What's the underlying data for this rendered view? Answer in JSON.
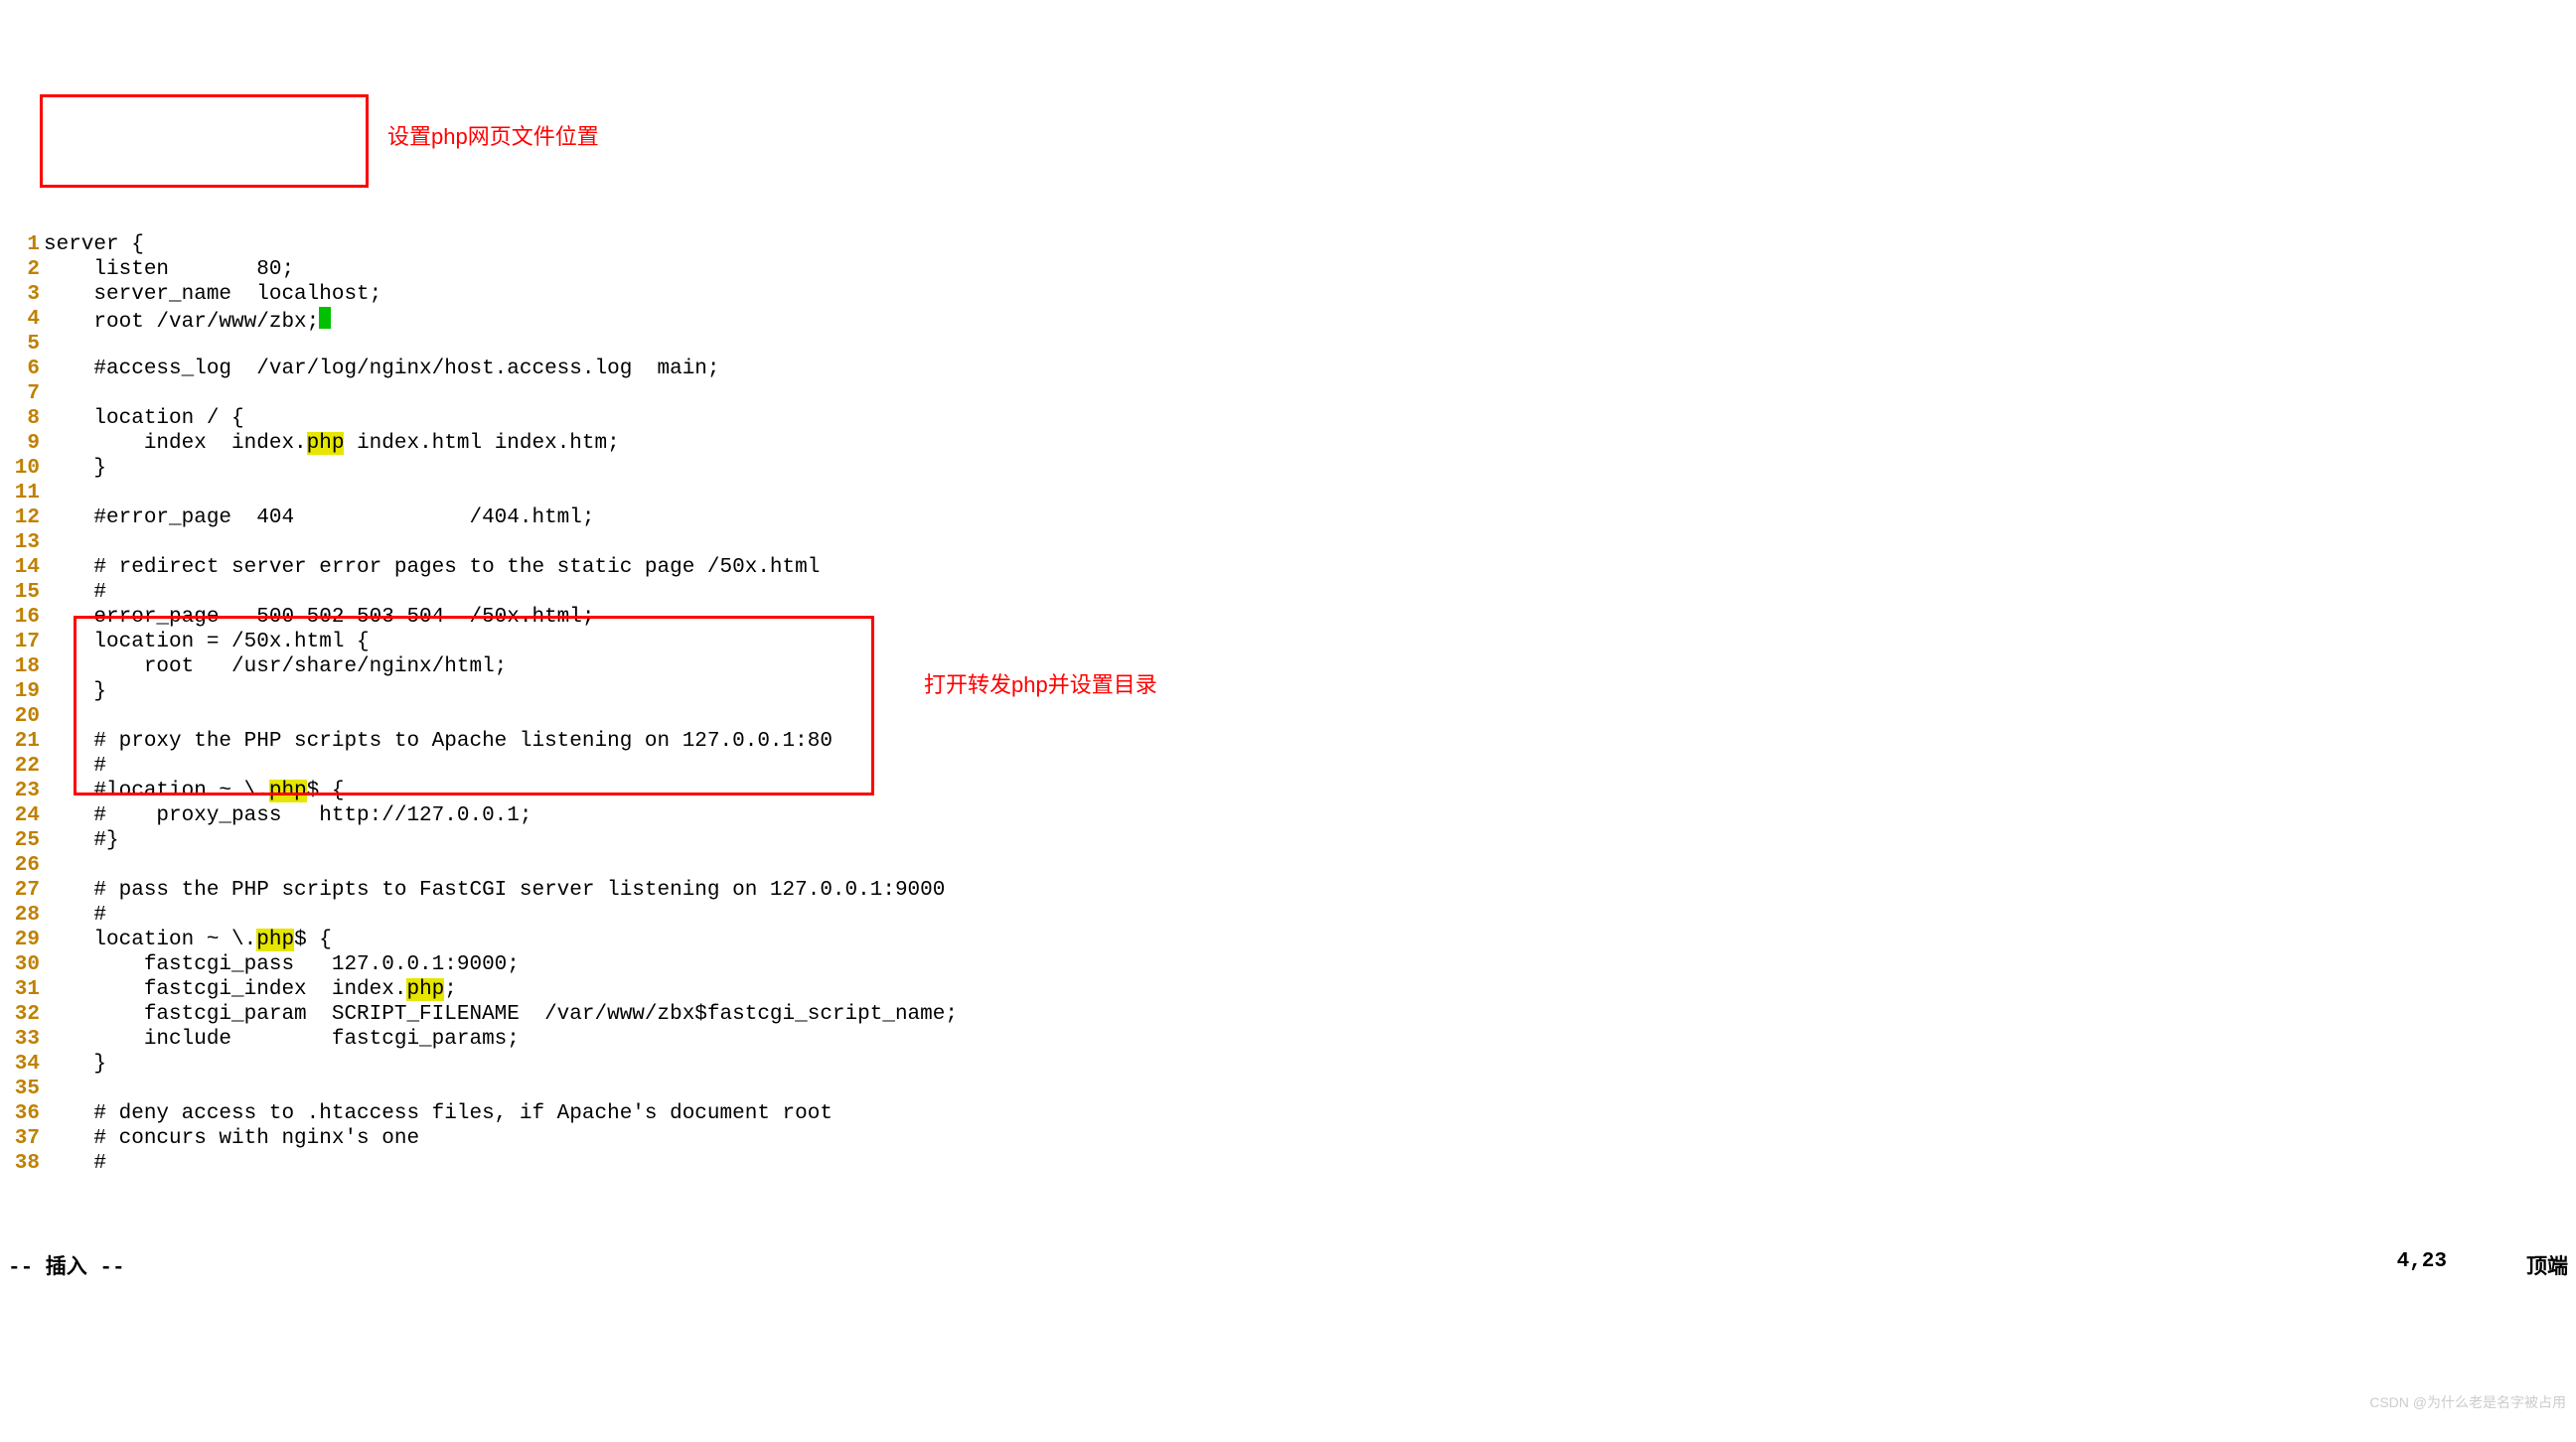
{
  "annotations": {
    "top": "设置php网页文件位置",
    "bottom": "打开转发php并设置目录"
  },
  "highlight_word": "php",
  "lines": [
    {
      "n": 1,
      "pre": "server {",
      "hl": null,
      "post": null
    },
    {
      "n": 2,
      "pre": "    listen       80;",
      "hl": null,
      "post": null
    },
    {
      "n": 3,
      "pre": "    server_name  localhost;",
      "hl": null,
      "post": null
    },
    {
      "n": 4,
      "pre": "    root /var/www/zbx;",
      "hl": null,
      "post": null,
      "cursor": true
    },
    {
      "n": 5,
      "pre": "",
      "hl": null,
      "post": null
    },
    {
      "n": 6,
      "pre": "    #access_log  /var/log/nginx/host.access.log  main;",
      "hl": null,
      "post": null
    },
    {
      "n": 7,
      "pre": "",
      "hl": null,
      "post": null
    },
    {
      "n": 8,
      "pre": "    location / {",
      "hl": null,
      "post": null
    },
    {
      "n": 9,
      "pre": "        index  index.",
      "hl": "php",
      "post": " index.html index.htm;"
    },
    {
      "n": 10,
      "pre": "    }",
      "hl": null,
      "post": null
    },
    {
      "n": 11,
      "pre": "",
      "hl": null,
      "post": null
    },
    {
      "n": 12,
      "pre": "    #error_page  404              /404.html;",
      "hl": null,
      "post": null
    },
    {
      "n": 13,
      "pre": "",
      "hl": null,
      "post": null
    },
    {
      "n": 14,
      "pre": "    # redirect server error pages to the static page /50x.html",
      "hl": null,
      "post": null
    },
    {
      "n": 15,
      "pre": "    #",
      "hl": null,
      "post": null
    },
    {
      "n": 16,
      "pre": "    error_page   500 502 503 504  /50x.html;",
      "hl": null,
      "post": null
    },
    {
      "n": 17,
      "pre": "    location = /50x.html {",
      "hl": null,
      "post": null
    },
    {
      "n": 18,
      "pre": "        root   /usr/share/nginx/html;",
      "hl": null,
      "post": null
    },
    {
      "n": 19,
      "pre": "    }",
      "hl": null,
      "post": null
    },
    {
      "n": 20,
      "pre": "",
      "hl": null,
      "post": null
    },
    {
      "n": 21,
      "pre": "    # proxy the PHP scripts to Apache listening on 127.0.0.1:80",
      "hl": null,
      "post": null
    },
    {
      "n": 22,
      "pre": "    #",
      "hl": null,
      "post": null
    },
    {
      "n": 23,
      "pre": "    #location ~ \\.",
      "hl": "php",
      "post": "$ {"
    },
    {
      "n": 24,
      "pre": "    #    proxy_pass   http://127.0.0.1;",
      "hl": null,
      "post": null
    },
    {
      "n": 25,
      "pre": "    #}",
      "hl": null,
      "post": null
    },
    {
      "n": 26,
      "pre": "",
      "hl": null,
      "post": null
    },
    {
      "n": 27,
      "pre": "    # pass the PHP scripts to FastCGI server listening on 127.0.0.1:9000",
      "hl": null,
      "post": null
    },
    {
      "n": 28,
      "pre": "    #",
      "hl": null,
      "post": null
    },
    {
      "n": 29,
      "pre": "    location ~ \\.",
      "hl": "php",
      "post": "$ {"
    },
    {
      "n": 30,
      "pre": "        fastcgi_pass   127.0.0.1:9000;",
      "hl": null,
      "post": null
    },
    {
      "n": 31,
      "pre": "        fastcgi_index  index.",
      "hl": "php",
      "post": ";"
    },
    {
      "n": 32,
      "pre": "        fastcgi_param  SCRIPT_FILENAME  /var/www/zbx$fastcgi_script_name;",
      "hl": null,
      "post": null
    },
    {
      "n": 33,
      "pre": "        include        fastcgi_params;",
      "hl": null,
      "post": null
    },
    {
      "n": 34,
      "pre": "    }",
      "hl": null,
      "post": null
    },
    {
      "n": 35,
      "pre": "",
      "hl": null,
      "post": null
    },
    {
      "n": 36,
      "pre": "    # deny access to .htaccess files, if Apache's document root",
      "hl": null,
      "post": null
    },
    {
      "n": 37,
      "pre": "    # concurs with nginx's one",
      "hl": null,
      "post": null
    },
    {
      "n": 38,
      "pre": "    #",
      "hl": null,
      "post": null
    }
  ],
  "status": {
    "mode": "-- 插入 --",
    "pos": "4,23",
    "scroll": "顶端"
  },
  "watermark": "CSDN @为什么老是名字被占用"
}
